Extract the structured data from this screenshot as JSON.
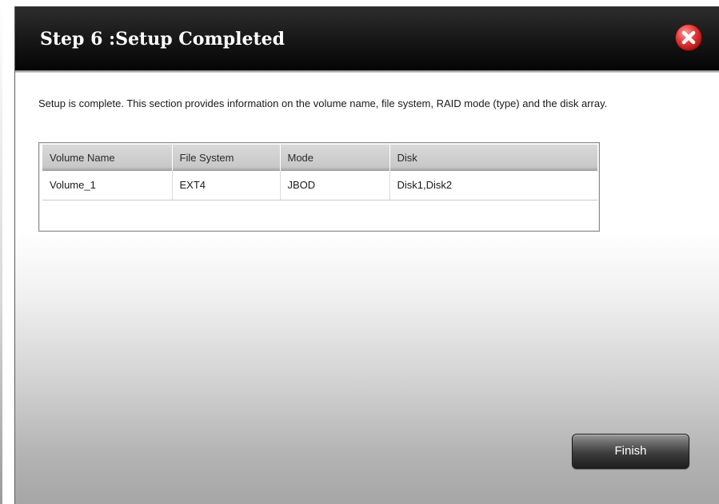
{
  "dialog": {
    "title": "Step 6 :Setup Completed",
    "close_icon": "close-icon",
    "description": "Setup is complete. This section provides information on the volume name, file system, RAID mode (type) and the disk array.",
    "finish_label": "Finish"
  },
  "table": {
    "columns": [
      "Volume Name",
      "File System",
      "Mode",
      "Disk"
    ],
    "rows": [
      [
        "Volume_1",
        "EXT4",
        "JBOD",
        "Disk1,Disk2"
      ]
    ]
  },
  "colors": {
    "title_bar": "#111111",
    "close_button": "#d32b2b",
    "table_header": "#cfcfcf",
    "finish_button": "#3a3a3a"
  }
}
